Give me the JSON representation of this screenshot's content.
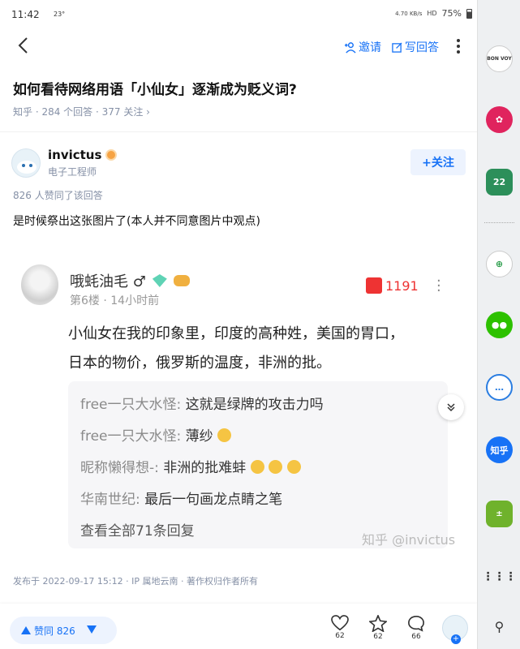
{
  "status": {
    "time": "11:42",
    "temp": "23°",
    "battery": "75%",
    "right_icons": "4.70 KB/s",
    "network": "HD"
  },
  "topbar": {
    "invite": "邀请",
    "write_answer": "写回答"
  },
  "question": {
    "title": "如何看待网络用语「小仙女」逐渐成为贬义词?",
    "meta": "知乎 · 284 个回答 · 377 关注 ›"
  },
  "author": {
    "name": "invictus",
    "job": "电子工程师",
    "follow": "+关注"
  },
  "answer": {
    "likes_note": "826 人赞同了该回答",
    "text": "是时候祭出这张图片了(本人并不同意图片中观点)"
  },
  "image": {
    "username": "哦蚝油毛 ♂",
    "floor": "第6楼   ·   14小时前",
    "like_count": "1191",
    "body_line1": "小仙女在我的印象里，印度的高种姓，美国的胃口，",
    "body_line2": "日本的物价，俄罗斯的温度，非洲的批。",
    "replies": [
      {
        "name": "free一只大水怪:",
        "text": " 这就是绿牌的攻击力吗",
        "emoji": 0
      },
      {
        "name": "free一只大水怪:",
        "text": " 薄纱",
        "emoji": 1
      },
      {
        "name": "昵称懒得想-:",
        "text": " 非洲的批难蚌",
        "emoji": 3
      },
      {
        "name": "华南世纪:",
        "text": " 最后一句画龙点睛之笔",
        "emoji": 0
      }
    ],
    "view_all": "查看全部71条回复",
    "watermark": "知乎 @invictus"
  },
  "publish_info": "发布于 2022-09-17 15:12 · IP 属地云南 · 著作权归作者所有",
  "bottombar": {
    "vote_label": "赞同 826",
    "like": "62",
    "favorite": "62",
    "comment": "66"
  },
  "dock": {
    "bonvoy": "BON VOY",
    "calendar_day": "22",
    "zhihu": "知乎"
  },
  "colors": {
    "accent": "#1772f6",
    "like_red": "#e33333"
  }
}
